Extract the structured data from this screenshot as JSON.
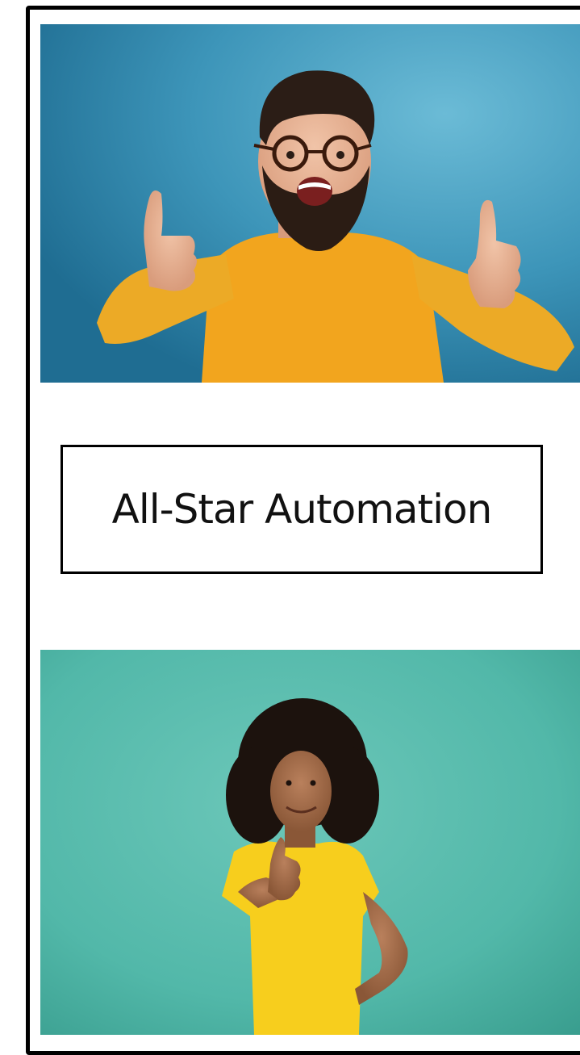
{
  "logo": {
    "text": "All-Star Automation"
  },
  "photos": [
    {
      "subject": "bearded-man-thumbs-up",
      "background": "#3d95b9",
      "shirt": "#f2a51e"
    },
    {
      "subject": "woman-thumbs-up",
      "background": "#52b8a9",
      "shirt": "#f7ce1d"
    }
  ],
  "colors": {
    "border": "#000000",
    "page": "#ffffff",
    "logo_text": "#111111"
  }
}
